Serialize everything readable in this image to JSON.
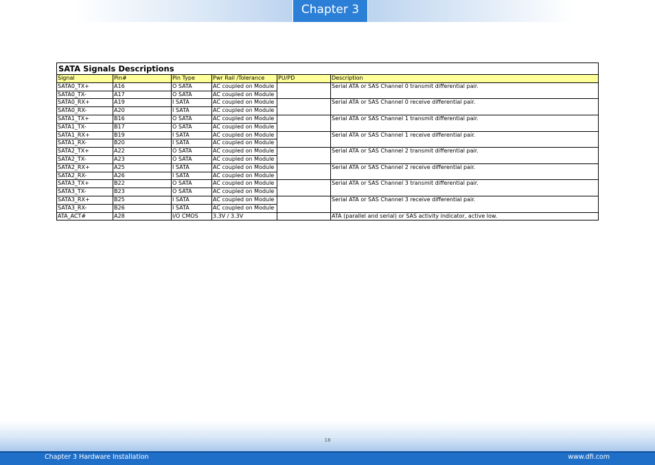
{
  "header": {
    "chapter_tab": "Chapter 3"
  },
  "table": {
    "title": "SATA Signals Descriptions",
    "columns": [
      "Signal",
      "Pin#",
      "Pin Type",
      "Pwr Rail /Tolerance",
      "PU/PD",
      "Description"
    ],
    "rows": [
      [
        "SATA0_TX+",
        "A16",
        "O SATA",
        "AC coupled on Module",
        "",
        "Serial ATA or SAS Channel 0 transmit differential pair."
      ],
      [
        "SATA0_TX-",
        "A17",
        "O SATA",
        "AC coupled on Module",
        "",
        ""
      ],
      [
        "SATA0_RX+",
        "A19",
        "I SATA",
        "AC coupled on Module",
        "",
        "Serial ATA or SAS Channel 0 receive differential pair."
      ],
      [
        "SATA0_RX-",
        "A20",
        "I SATA",
        "AC coupled on Module",
        "",
        ""
      ],
      [
        "SATA1_TX+",
        "B16",
        "O SATA",
        "AC coupled on Module",
        "",
        "Serial ATA or SAS Channel 1 transmit differential pair."
      ],
      [
        "SATA1_TX-",
        "B17",
        "O SATA",
        "AC coupled on Module",
        "",
        ""
      ],
      [
        "SATA1_RX+",
        "B19",
        "I SATA",
        "AC coupled on Module",
        "",
        "Serial ATA or SAS Channel 1 receive differential pair."
      ],
      [
        "SATA1_RX-",
        "B20",
        "I SATA",
        "AC coupled on Module",
        "",
        ""
      ],
      [
        "SATA2_TX+",
        "A22",
        "O SATA",
        "AC coupled on Module",
        "",
        "Serial ATA or SAS Channel 2 transmit differential pair."
      ],
      [
        "SATA2_TX-",
        "A23",
        "O SATA",
        "AC coupled on Module",
        "",
        ""
      ],
      [
        "SATA2_RX+",
        "A25",
        "I SATA",
        "AC coupled on Module",
        "",
        "Serial ATA or SAS Channel 2 receive differential pair."
      ],
      [
        "SATA2_RX-",
        "A26",
        "I SATA",
        "AC coupled on Module",
        "",
        ""
      ],
      [
        "SATA3_TX+",
        "B22",
        "O SATA",
        "AC coupled on Module",
        "",
        "Serial ATA or SAS Channel 3 transmit differential pair."
      ],
      [
        "SATA3_TX-",
        "B23",
        "O SATA",
        "AC coupled on Module",
        "",
        ""
      ],
      [
        "SATA3_RX+",
        "B25",
        "I SATA",
        "AC coupled on Module",
        "",
        "Serial ATA or SAS Channel 3 receive differential pair."
      ],
      [
        "SATA3_RX-",
        "B26",
        "I SATA",
        "AC coupled on Module",
        "",
        ""
      ],
      [
        "ATA_ACT#",
        "A28",
        "I/O CMOS",
        "3.3V / 3.3V",
        "",
        "ATA (parallel and serial) or SAS activity indicator, active low."
      ]
    ]
  },
  "footer": {
    "page_number": "18",
    "left_text": "Chapter 3 Hardware Installation",
    "right_text": "www.dfi.com"
  },
  "colors": {
    "accent": "#2b7fd6",
    "footer_bar": "#1f6fc8",
    "header_row": "#ffff99"
  }
}
